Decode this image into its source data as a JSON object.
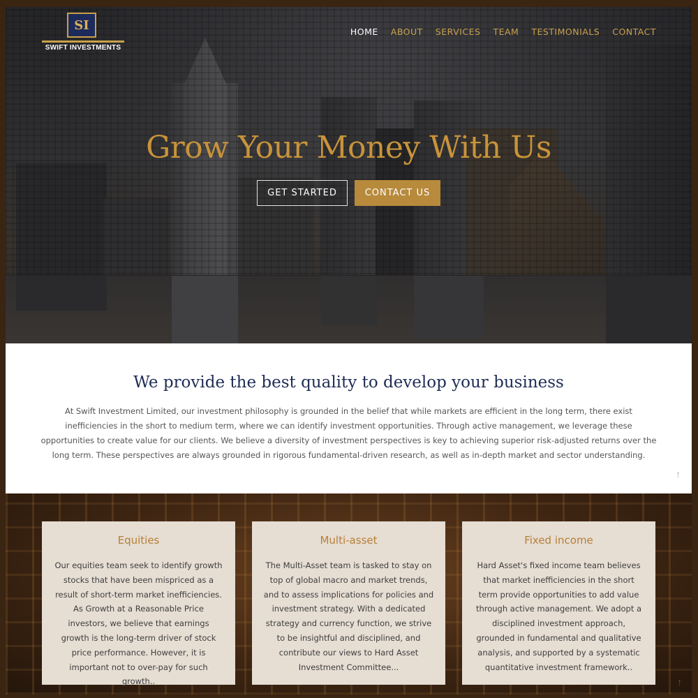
{
  "brand": {
    "logo_mark": "SI",
    "name": "SWIFT INVESTMENTS"
  },
  "nav": {
    "items": [
      {
        "label": "HOME",
        "active": true
      },
      {
        "label": "ABOUT",
        "active": false
      },
      {
        "label": "SERVICES",
        "active": false
      },
      {
        "label": "TEAM",
        "active": false
      },
      {
        "label": "TESTIMONIALS",
        "active": false
      },
      {
        "label": "CONTACT",
        "active": false
      }
    ]
  },
  "hero": {
    "title": "Grow Your Money With Us",
    "primary_button": "GET STARTED",
    "secondary_button": "CONTACT US"
  },
  "about": {
    "heading": "We provide the best quality to develop your business",
    "body": "At Swift Investment Limited, our investment philosophy is grounded in the belief that while markets are efficient in the long term, there exist inefficiencies in the short to medium term, where we can identify investment opportunities. Through active management, we leverage these opportunities to create value for our clients. We believe a diversity of investment perspectives is key to achieving superior risk-adjusted returns over the long term. These perspectives are always grounded in rigorous fundamental-driven research, as well as in-depth market and sector understanding.",
    "scroll_icon": "arrow-up-icon"
  },
  "services": {
    "cards": [
      {
        "title": "Equities",
        "text": "Our equities team seek to identify growth stocks that have been mispriced as a result of short-term market inefficiencies. As Growth at a Reasonable Price investors, we believe that earnings growth is the long-term driver of stock price performance. However, it is important not to over-pay for such growth.."
      },
      {
        "title": "Multi-asset",
        "text": "The Multi-Asset team is tasked to stay on top of global macro and market trends, and to assess implications for policies and investment strategy. With a dedicated strategy and currency function, we strive to be insightful and disciplined, and contribute our views to Hard Asset Investment Committee..."
      },
      {
        "title": "Fixed income",
        "text": "Hard Asset's fixed income team believes that market inefficiencies in the short term provide opportunities to add value through active management. We adopt a disciplined investment approach, grounded in fundamental and qualitative analysis, and supported by a systematic quantitative investment framework.."
      }
    ]
  },
  "colors": {
    "accent_gold": "#c8933a",
    "nav_gold": "#c8a04f",
    "navy": "#1f2d55",
    "card_bg": "#e6ddd3",
    "frame": "#3a2412"
  }
}
